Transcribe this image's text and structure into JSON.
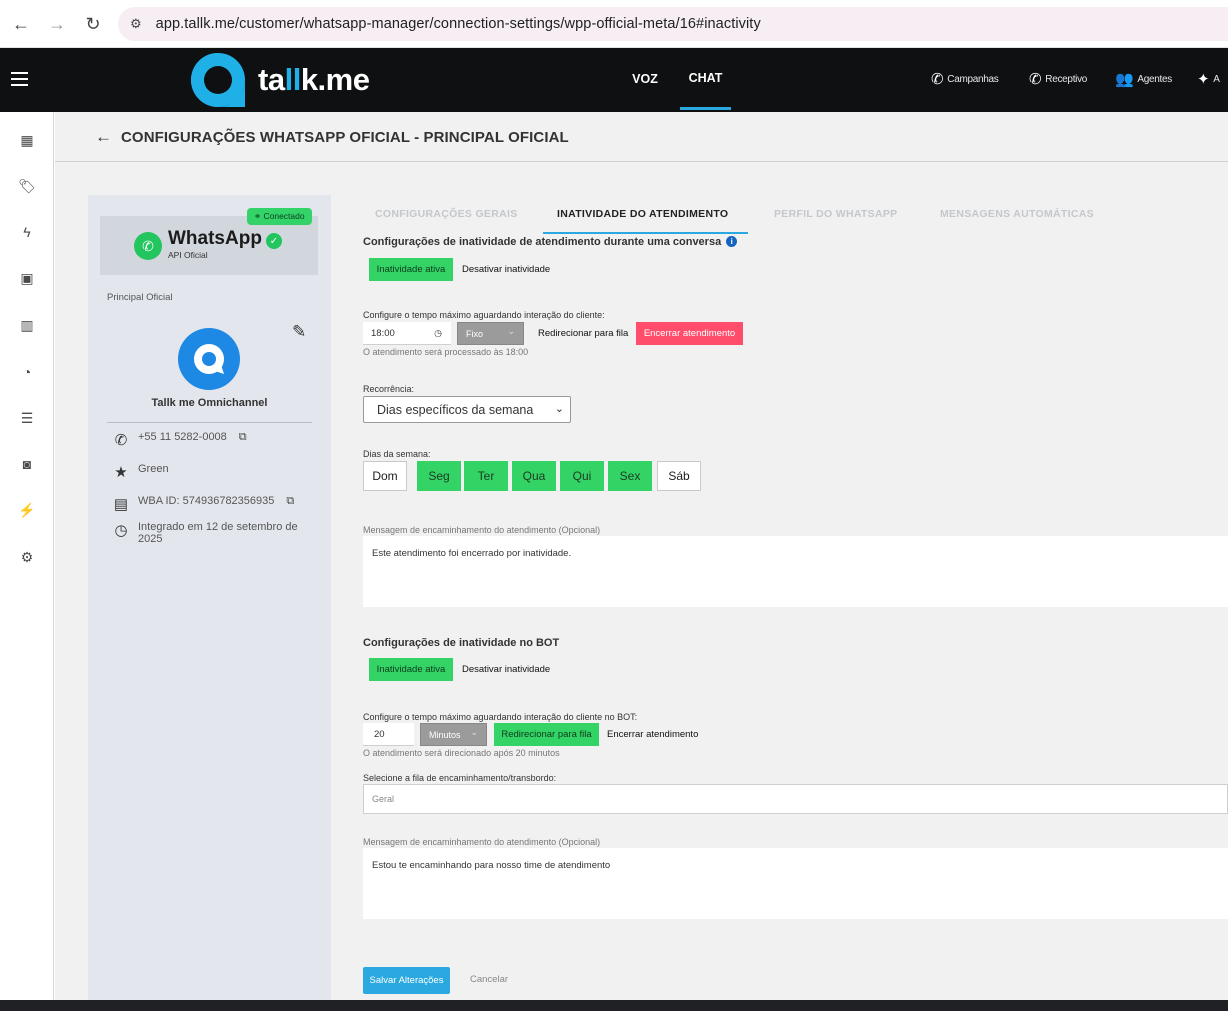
{
  "browser": {
    "url": "app.tallk.me/customer/whatsapp-manager/connection-settings/wpp-official-meta/16#inactivity"
  },
  "header": {
    "logo": {
      "prefix": "ta",
      "highlight": "ll",
      "suffix": "k.me"
    },
    "tabs": [
      {
        "label": "VOZ"
      },
      {
        "label": "CHAT",
        "active": true
      }
    ],
    "links": [
      {
        "label": "Campanhas",
        "icon": "phone-campaign-icon"
      },
      {
        "label": "Receptivo",
        "icon": "phone-inbound-icon"
      },
      {
        "label": "Agentes",
        "icon": "agents-icon"
      },
      {
        "label": "A",
        "icon": "sparkles-icon"
      }
    ]
  },
  "page": {
    "title": "CONFIGURAÇÕES WHATSAPP OFICIAL - PRINCIPAL OFICIAL"
  },
  "side_card": {
    "status_badge": "Conectado",
    "brand_title": "WhatsApp",
    "brand_subtitle": "API Oficial",
    "label": "Principal Oficial",
    "account_name": "Tallk me Omnichannel",
    "phone": "+55 11 5282-0008",
    "quality": "Green",
    "wba_id": "WBA ID: 574936782356935",
    "integrated": "Integrado em 12 de setembro de 2025"
  },
  "tabs": [
    {
      "label": "CONFIGURAÇÕES GERAIS",
      "active": false
    },
    {
      "label": "INATIVIDADE DO ATENDIMENTO",
      "active": true
    },
    {
      "label": "PERFIL DO WHATSAPP",
      "active": false
    },
    {
      "label": "MENSAGENS AUTOMÁTICAS",
      "active": false
    }
  ],
  "conversation": {
    "title": "Configurações de inatividade de atendimento durante uma conversa",
    "toggle_active": "Inatividade ativa",
    "toggle_inactive": "Desativar inatividade",
    "time_label": "Configure o tempo máximo aguardando interação do cliente:",
    "time_value": "18:00",
    "mode": "Fixo",
    "redirect_label": "Redirecionar para fila",
    "close_label": "Encerrar atendimento",
    "time_hint": "O atendimento será processado às 18:00",
    "recurrence_label": "Recorrência:",
    "recurrence_value": "Dias específicos da semana",
    "days_label": "Dias da semana:",
    "days": [
      {
        "label": "Dom",
        "on": false
      },
      {
        "label": "Seg",
        "on": true
      },
      {
        "label": "Ter",
        "on": true
      },
      {
        "label": "Qua",
        "on": true
      },
      {
        "label": "Qui",
        "on": true
      },
      {
        "label": "Sex",
        "on": true
      },
      {
        "label": "Sáb",
        "on": false
      }
    ],
    "message_label": "Mensagem de encaminhamento do atendimento (Opcional)",
    "message_value": "Este atendimento foi encerrado por inatividade."
  },
  "bot": {
    "title": "Configurações de inatividade no BOT",
    "toggle_active": "Inatividade ativa",
    "toggle_inactive": "Desativar inatividade",
    "time_label": "Configure o tempo máximo aguardando interação do cliente no BOT:",
    "time_value": "20",
    "unit": "Minutos",
    "redirect_label": "Redirecionar para fila",
    "close_label": "Encerrar atendimento",
    "time_hint": "O atendimento será direcionado após 20 minutos",
    "queue_label": "Selecione a fila de encaminhamento/transbordo:",
    "queue_value": "Geral",
    "message_label": "Mensagem de encaminhamento do atendimento (Opcional)",
    "message_value": "Estou te encaminhando para nosso time de atendimento"
  },
  "actions": {
    "save": "Salvar Alterações",
    "cancel": "Cancelar"
  },
  "colors": {
    "accent": "#2aa9e0",
    "green": "#34d366",
    "red": "#ff4d6b"
  }
}
